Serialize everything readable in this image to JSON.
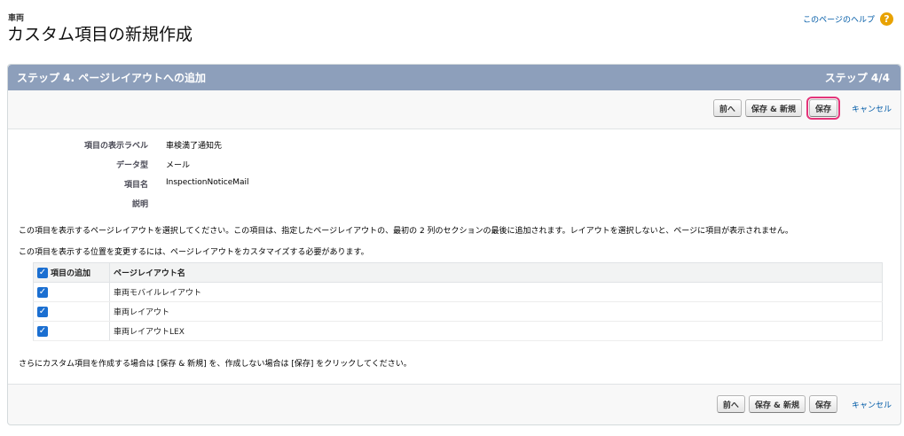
{
  "header": {
    "object_name": "車両",
    "title": "カスタム項目の新規作成"
  },
  "help": {
    "link_label": "このページのヘルプ",
    "icon": "help-icon"
  },
  "step": {
    "title": "ステップ 4. ページレイアウトへの追加",
    "counter": "ステップ 4/4"
  },
  "buttons": {
    "prev": "前へ",
    "save_new": "保存 & 新規",
    "save": "保存",
    "cancel": "キャンセル"
  },
  "fields": {
    "label_label": "項目の表示ラベル",
    "label_value": "車検満了通知先",
    "type_label": "データ型",
    "type_value": "メール",
    "name_label": "項目名",
    "name_value": "InspectionNoticeMail",
    "desc_label": "説明",
    "desc_value": ""
  },
  "info": {
    "line1": "この項目を表示するページレイアウトを選択してください。この項目は、指定したページレイアウトの、最初の 2 列のセクションの最後に追加されます。レイアウトを選択しないと、ページに項目が表示されません。",
    "line2": "この項目を表示する位置を変更するには、ページレイアウトをカスタマイズする必要があります。",
    "footer": "さらにカスタム項目を作成する場合は [保存 & 新規] を、作成しない場合は [保存] をクリックしてください。"
  },
  "layout_table": {
    "header_add": "項目の追加",
    "header_name": "ページレイアウト名",
    "rows": [
      {
        "checked": true,
        "name": "車両モバイルレイアウト"
      },
      {
        "checked": true,
        "name": "車両レイアウト"
      },
      {
        "checked": true,
        "name": "車両レイアウトLEX"
      }
    ]
  }
}
